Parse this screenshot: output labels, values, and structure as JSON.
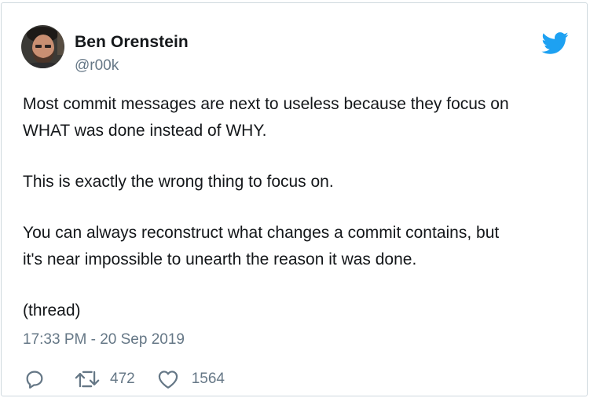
{
  "tweet": {
    "author": {
      "name": "Ben Orenstein",
      "handle": "@r00k"
    },
    "paragraphs": [
      [
        "Most commit messages are next to useless because they focus on",
        "WHAT was done instead of WHY."
      ],
      [
        "This is exactly the wrong thing to focus on."
      ],
      [
        "You can always reconstruct what changes a commit contains, but",
        "it's near impossible to unearth the reason it was done."
      ],
      [
        "(thread)"
      ]
    ],
    "timestamp": "17:33 PM - 20 Sep 2019",
    "actions": {
      "reply_icon": "reply-icon",
      "retweet_icon": "retweet-icon",
      "retweet_count": "472",
      "like_icon": "heart-icon",
      "like_count": "1564"
    }
  },
  "brand": {
    "icon": "twitter-bird-icon",
    "accent_color": "#1da1f2",
    "muted_color": "#657786",
    "text_color": "#14171a"
  }
}
